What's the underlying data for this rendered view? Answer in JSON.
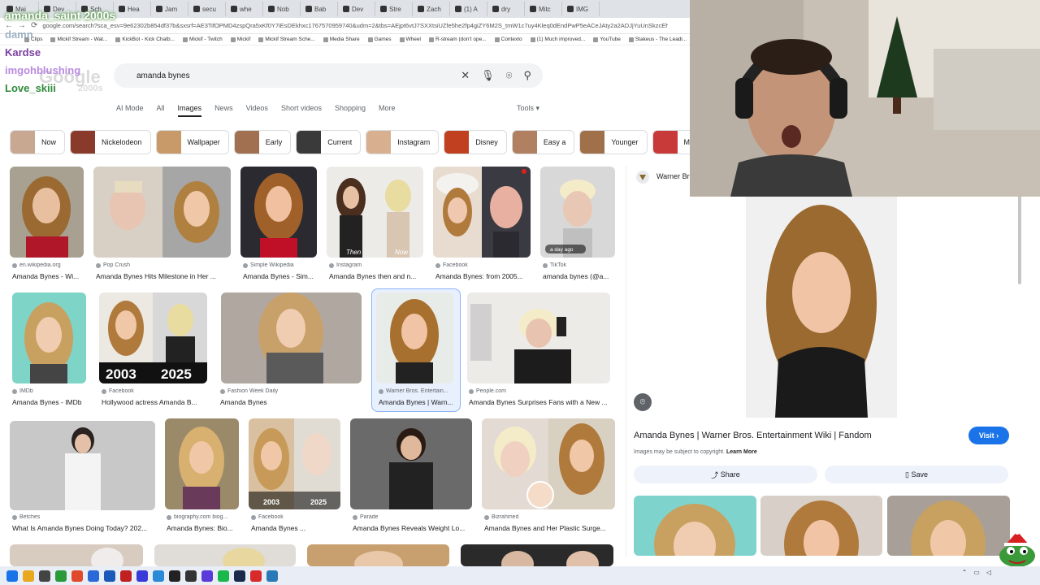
{
  "browser": {
    "tabs": [
      "Mai",
      "Dev",
      "Sch",
      "Hea",
      "Jam",
      "secu",
      "whe",
      "Nob",
      "Bab",
      "Dev",
      "Stre",
      "Zach",
      "(1) A",
      "dry",
      "Mitc",
      "IMG"
    ],
    "url": "google.com/search?sca_esv=9e62302b854df37b&sxsrf=AE3TifOPMD4zspQra5xKf0Y7iEsDEkhxc1767570959740&udm=2&tbs=AEjpt6vtJ7SXXtsiUZfe5he2fp4giZY6M2S_tmW1c7uy4Kleq0dEndPwP5eACeJAty2a2ADJjYuUnSkzcEhozVdaq1wZrEhwAY38UpnR",
    "bookmarks": [
      "Clips",
      "Mickif Stream - Wat...",
      "KickBot - Kick Chatb...",
      "Mickif - Twitch",
      "Mickif",
      "Mickif Stream Sche...",
      "Media Share",
      "Games",
      "Wheel",
      "R-stream (don't ope...",
      "Contexto",
      "(1) Much improved...",
      "YouTube",
      "Stakeus - The Leadi..."
    ]
  },
  "chat": {
    "line1": "amanda_saint 2000s",
    "line2": "damn",
    "line3": "Kardse",
    "line4": "imgohblushing",
    "line5": "Love_skiii",
    "line6": "2000s"
  },
  "google": {
    "logo": "Google",
    "query": "amanda bynes",
    "nav": [
      "AI Mode",
      "All",
      "Images",
      "News",
      "Videos",
      "Short videos",
      "Shopping",
      "More"
    ],
    "tools": "Tools",
    "chips": [
      "Now",
      "Nickelodeon",
      "Wallpaper",
      "Early",
      "Current",
      "Instagram",
      "Disney",
      "Easy a",
      "Younger",
      "Movie"
    ]
  },
  "results": [
    {
      "source": "en.wikipedia.org",
      "title": "Amanda Bynes - Wi..."
    },
    {
      "source": "Pop Crush",
      "title": "Amanda Bynes Hits Milestone in Her ..."
    },
    {
      "source": "Simple Wikipedia",
      "title": "Amanda Bynes - Sim..."
    },
    {
      "source": "Instagram",
      "title": "Amanda Bynes then and n..."
    },
    {
      "source": "Facebook",
      "title": "Amanda Bynes: from 2005..."
    },
    {
      "source": "TikTok",
      "title": "amanda bynes (@a..."
    },
    {
      "source": "IMDb",
      "title": "Amanda Bynes - IMDb"
    },
    {
      "source": "Facebook",
      "title": "Hollywood actress Amanda B..."
    },
    {
      "source": "Fashion Week Daily",
      "title": "Amanda Bynes"
    },
    {
      "source": "Warner Bros. Entertain...",
      "title": "Amanda Bynes | Warn..."
    },
    {
      "source": "People.com",
      "title": "Amanda Bynes Surprises Fans with a New ..."
    },
    {
      "source": "Betches",
      "title": "What Is Amanda Bynes Doing Today? 202..."
    },
    {
      "source": "biography.com biog...",
      "title": "Amanda Bynes: Bio..."
    },
    {
      "source": "Facebook",
      "title": "Amanda Bynes ..."
    },
    {
      "source": "Parade",
      "title": "Amanda Bynes Reveals Weight Lo..."
    },
    {
      "source": "Bizrahmed",
      "title": "Amanda Bynes and Her Plastic Surge..."
    }
  ],
  "image_labels": {
    "then": "Then",
    "now": "Now",
    "ago": "a day ago",
    "y2003": "2003",
    "y2025": "2025",
    "y2003b": "2003",
    "y2025b": "2025"
  },
  "panel": {
    "source": "Warner Bros.",
    "title": "Amanda Bynes | Warner Bros. Entertainment Wiki | Fandom",
    "visit": "Visit",
    "copyright": "Images may be subject to copyright.",
    "learn_more": "Learn More",
    "share": "Share",
    "save": "Save"
  }
}
